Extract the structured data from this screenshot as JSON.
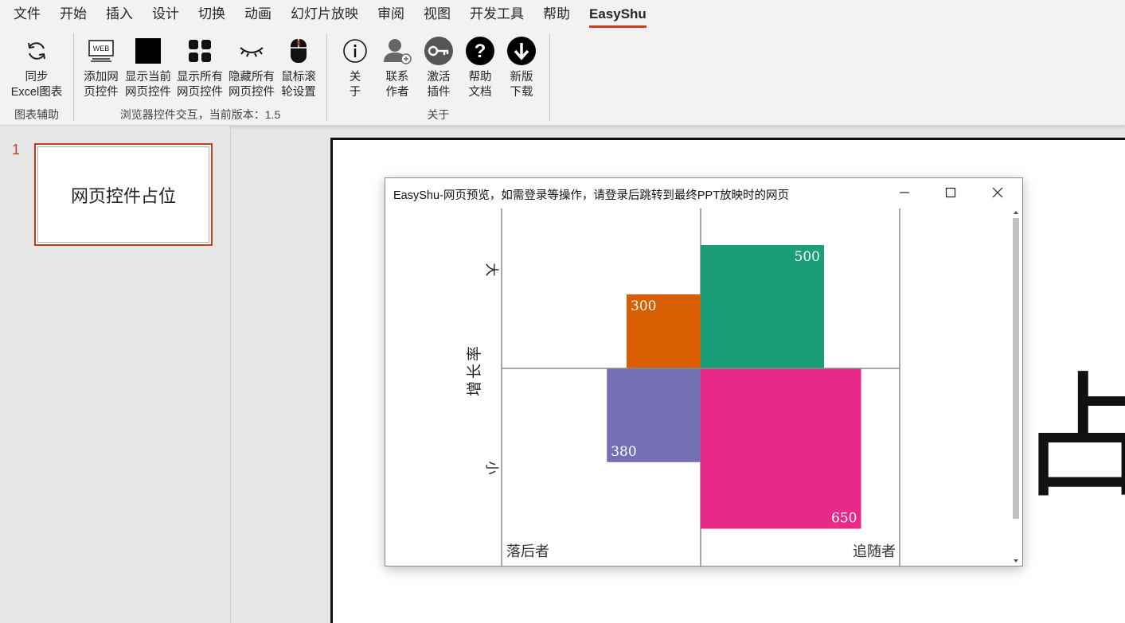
{
  "menu": {
    "items": [
      "文件",
      "开始",
      "插入",
      "设计",
      "切换",
      "动画",
      "幻灯片放映",
      "审阅",
      "视图",
      "开发工具",
      "帮助",
      "EasyShu"
    ],
    "active": "EasyShu"
  },
  "ribbon": {
    "group1": {
      "label": "图表辅助",
      "sync": [
        "同步",
        "Excel图表"
      ]
    },
    "group2": {
      "label": "浏览器控件交互，当前版本：1.5",
      "add": [
        "添加网",
        "页控件"
      ],
      "show_current": [
        "显示当前",
        "网页控件"
      ],
      "show_all": [
        "显示所有",
        "网页控件"
      ],
      "hide_all": [
        "隐藏所有",
        "网页控件"
      ],
      "mouse": [
        "鼠标滚",
        "轮设置"
      ],
      "web_icon_text": "WEB"
    },
    "group3": {
      "label": "关于",
      "about": [
        "关",
        "于"
      ],
      "contact": [
        "联系",
        "作者"
      ],
      "activate": [
        "激活",
        "插件"
      ],
      "help": [
        "帮助",
        "文档"
      ],
      "download": [
        "新版",
        "下载"
      ]
    }
  },
  "thumbnail": {
    "number": "1",
    "text": "网页控件占位"
  },
  "slide": {
    "big_text": "占位"
  },
  "dialog": {
    "title": "EasyShu-网页预览，如需登录等操作，请登录后跳转到最终PPT放映时的网页"
  },
  "chart_data": {
    "type": "bar",
    "ylabel": "增长率",
    "y_top_label": "大",
    "y_bottom_label": "小",
    "quadrant_labels": {
      "bottom_left": "落后者",
      "bottom_right": "追随者"
    },
    "bars": [
      {
        "value": 300,
        "color": "#d95f02",
        "quadrant": "top-left"
      },
      {
        "value": 500,
        "color": "#1b9e77",
        "quadrant": "top-right"
      },
      {
        "value": 380,
        "color": "#7570b3",
        "quadrant": "bottom-left"
      },
      {
        "value": 650,
        "color": "#e7298a",
        "quadrant": "bottom-right"
      }
    ]
  }
}
